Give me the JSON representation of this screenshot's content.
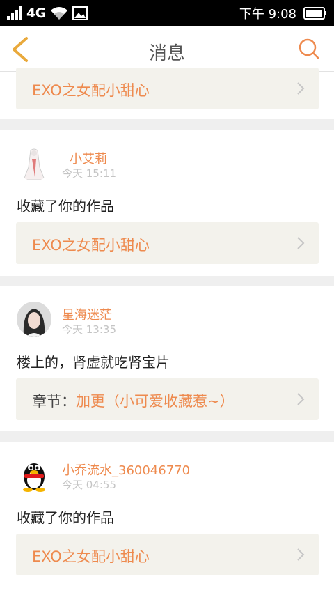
{
  "status_bar": {
    "network": "4G",
    "time": "下午 9:08",
    "icons": [
      "signal-icon",
      "wifi-icon",
      "image-icon",
      "battery-icon"
    ]
  },
  "header": {
    "title": "消息",
    "back_icon": "chevron-left-icon",
    "search_icon": "search-icon",
    "accent_color": "#e9a93b"
  },
  "colors": {
    "username": "#ee8a4e",
    "link_bg": "#f3f2ec"
  },
  "messages": [
    {
      "link_text": "EXO之女配小甜心"
    },
    {
      "username": "小艾莉",
      "time": "今天 15:11",
      "text": "收藏了你的作品",
      "link_text": "EXO之女配小甜心"
    },
    {
      "username": "星海迷茫",
      "time": "今天 13:35",
      "text": "楼上的，肾虚就吃肾宝片",
      "link_prefix": "章节：",
      "link_text": "加更（小可爱收藏惹~）"
    },
    {
      "username": "小乔流水_360046770",
      "time": "今天 04:55",
      "text": "收藏了你的作品",
      "link_text": "EXO之女配小甜心"
    }
  ]
}
